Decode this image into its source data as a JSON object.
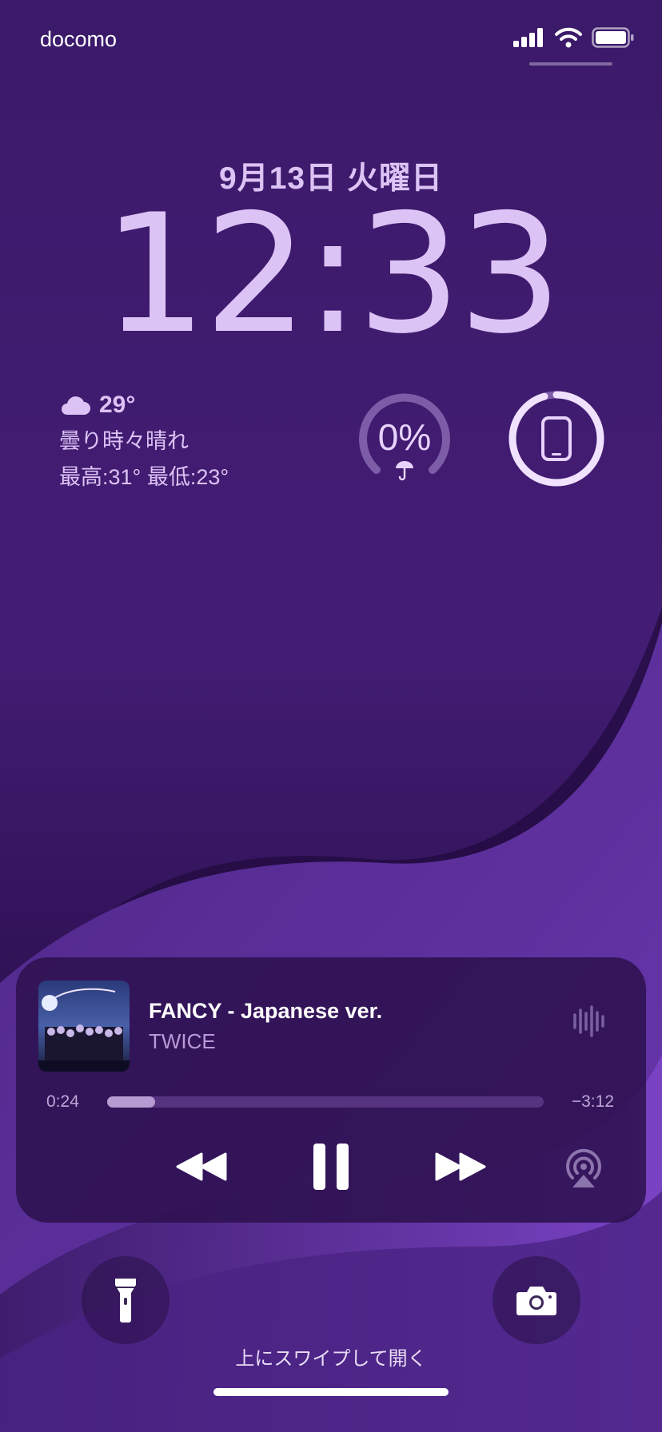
{
  "status_bar": {
    "carrier": "docomo"
  },
  "lock_screen": {
    "date": "9月13日 火曜日",
    "time": "12:33"
  },
  "weather": {
    "temperature": "29°",
    "condition": "曇り時々晴れ",
    "high_low": "最高:31° 最低:23°",
    "icon": "cloud-icon"
  },
  "rain_widget": {
    "percent_label": "0%",
    "icon": "umbrella-icon"
  },
  "device_widget": {
    "icon": "phone-icon"
  },
  "now_playing": {
    "title": "FANCY - Japanese ver.",
    "artist": "TWICE",
    "elapsed": "0:24",
    "remaining": "−3:12",
    "progress_fraction": 0.11
  },
  "controls": {
    "rewind": "rewind-icon",
    "pause": "pause-icon",
    "forward": "fast-forward-icon",
    "airplay": "airplay-icon"
  },
  "bottom": {
    "swipe_hint": "上にスワイプして開く"
  },
  "colors": {
    "accent_text": "#dcc3f5",
    "player_bg": "#2c104e",
    "wallpaper_dark": "#1c0838",
    "wallpaper_light": "#6a3aa8"
  }
}
